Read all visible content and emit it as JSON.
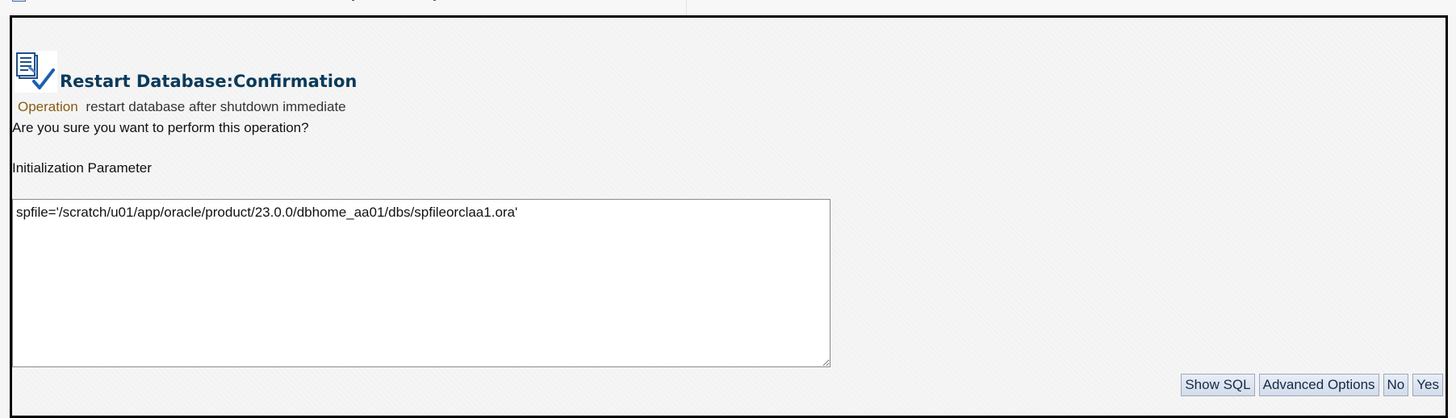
{
  "page": {
    "title": "Restart Database:Confirmation",
    "operation_label": "Operation",
    "operation_value": "restart database after shutdown immediate",
    "question": "Are you sure you want to perform this operation?",
    "init_param_label": "Initialization Parameter",
    "init_param_value": "spfile='/scratch/u01/app/oracle/product/23.0.0/dbhome_aa01/dbs/spfileorclaa1.ora'"
  },
  "buttons": {
    "show_sql": "Show SQL",
    "advanced_options": "Advanced Options",
    "no": "No",
    "yes": "Yes"
  },
  "icons": {
    "title_icon": "confirmation-document-check-icon"
  },
  "colors": {
    "title": "#0b3a5a",
    "operation_label": "#8a5a10",
    "panel_border": "#000000",
    "button_text": "#14284a"
  }
}
